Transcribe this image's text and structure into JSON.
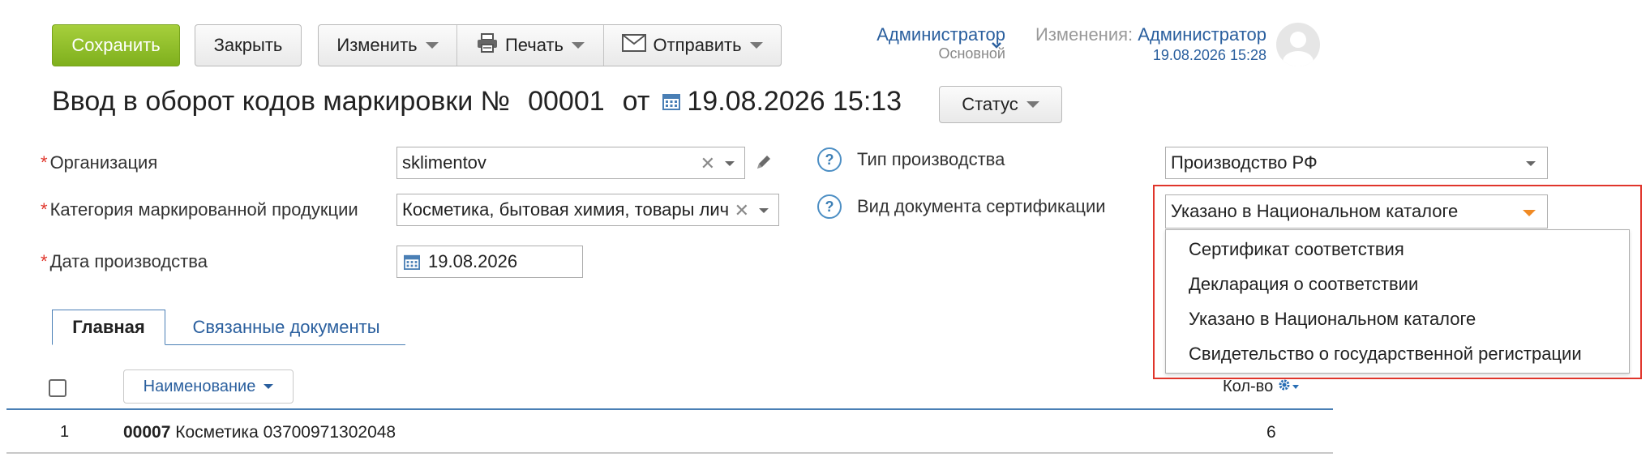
{
  "toolbar": {
    "save_label": "Сохранить",
    "close_label": "Закрыть",
    "change_label": "Изменить",
    "print_label": "Печать",
    "send_label": "Отправить"
  },
  "user": {
    "name": "Администратор",
    "role": "Основной",
    "changes_prefix": "Изменения:",
    "changes_user": "Администратор",
    "changes_date": "19.08.2026 15:28"
  },
  "header": {
    "title": "Ввод в оборот кодов маркировки №",
    "number": "00001",
    "from": "от",
    "datetime": "19.08.2026 15:13",
    "status_label": "Статус"
  },
  "form": {
    "organization": {
      "label": "Организация",
      "value": "sklimentov"
    },
    "category": {
      "label": "Категория маркированной продукции",
      "value": "Косметика, бытовая химия, товары лич"
    },
    "production_date": {
      "label": "Дата производства",
      "value": "19.08.2026"
    },
    "production_type": {
      "label": "Тип производства",
      "value": "Производство РФ"
    },
    "cert_type": {
      "label": "Вид документа сертификации",
      "value": "Указано в Национальном каталоге"
    }
  },
  "dropdown": {
    "options": [
      "Сертификат соответствия",
      "Декларация о соответствии",
      "Указано в Национальном каталоге",
      "Свидетельство о государственной регистрации"
    ]
  },
  "tabs": [
    {
      "label": "Главная",
      "active": true
    },
    {
      "label": "Связанные документы",
      "active": false
    }
  ],
  "table": {
    "name_header": "Наименование",
    "qty_header": "Кол-во",
    "rows": [
      {
        "num": "1",
        "code": "00007",
        "name": "Косметика 03700971302048",
        "qty": "6"
      }
    ]
  },
  "colors": {
    "save_green": "#8cbd28",
    "link_blue": "#2a5f9e",
    "highlight_red": "#e0352b",
    "accent_orange": "#f08a24"
  }
}
